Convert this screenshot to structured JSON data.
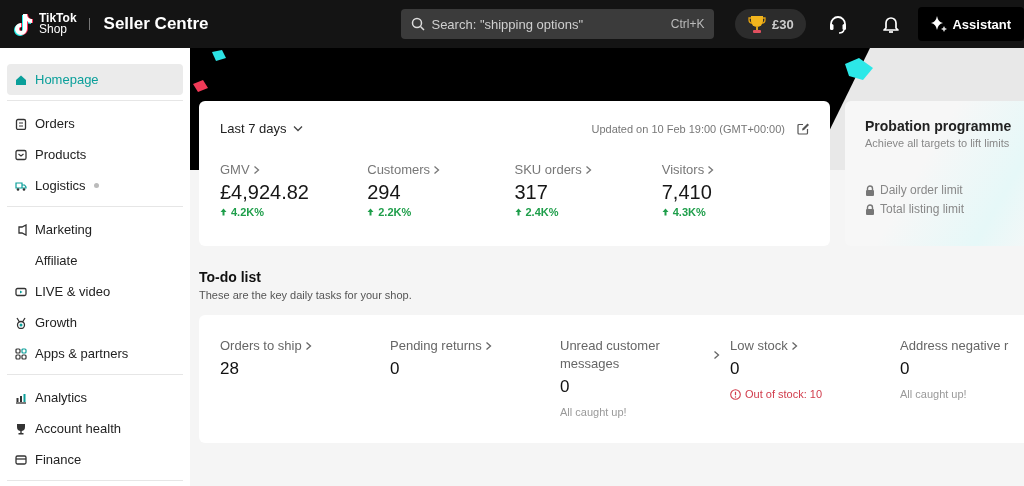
{
  "header": {
    "logo_top": "TikTok",
    "logo_bottom": "Shop",
    "title": "Seller Centre",
    "search": {
      "placeholder": "Search: \"shipping options\"",
      "shortcut": "Ctrl+K"
    },
    "reward": "£30",
    "assistant": "Assistant"
  },
  "sidebar": {
    "sections": [
      {
        "items": [
          {
            "label": "Homepage",
            "selected": true,
            "dot": false
          }
        ]
      },
      {
        "items": [
          {
            "label": "Orders",
            "selected": false,
            "dot": false
          },
          {
            "label": "Products",
            "selected": false,
            "dot": false
          },
          {
            "label": "Logistics",
            "selected": false,
            "dot": true
          }
        ]
      },
      {
        "items": [
          {
            "label": "Marketing",
            "selected": false,
            "dot": false
          },
          {
            "label": "Affiliate",
            "selected": false,
            "dot": false
          },
          {
            "label": "LIVE & video",
            "selected": false,
            "dot": false
          },
          {
            "label": "Growth",
            "selected": false,
            "dot": false
          },
          {
            "label": "Apps & partners",
            "selected": false,
            "dot": false
          }
        ]
      },
      {
        "items": [
          {
            "label": "Analytics",
            "selected": false,
            "dot": false
          },
          {
            "label": "Account health",
            "selected": false,
            "dot": false
          },
          {
            "label": "Finance",
            "selected": false,
            "dot": false
          }
        ]
      }
    ]
  },
  "stats": {
    "period": "Last 7 days",
    "updated": "Updated on 10 Feb 19:00 (GMT+00:00)",
    "metrics": [
      {
        "label": "GMV",
        "value": "£4,924.82",
        "change": "4.2K%",
        "rising": true
      },
      {
        "label": "Customers",
        "value": "294",
        "change": "2.2K%",
        "rising": true
      },
      {
        "label": "SKU orders",
        "value": "317",
        "change": "2.4K%",
        "rising": true
      },
      {
        "label": "Visitors",
        "value": "7,410",
        "change": "4.3K%",
        "rising": true
      }
    ]
  },
  "probation": {
    "title": "Probation programme",
    "subtitle": "Achieve all targets to lift limits",
    "limits": [
      {
        "label": "Daily order limit",
        "locked": true
      },
      {
        "label": "Total listing limit",
        "locked": true
      }
    ]
  },
  "todo": {
    "title": "To-do list",
    "subtitle": "These are the key daily tasks for your shop.",
    "tasks": [
      {
        "label": "Orders to ship",
        "value": "28",
        "link": true
      },
      {
        "label": "Pending returns",
        "value": "0",
        "link": true
      },
      {
        "label": "Unread customer messages",
        "value": "0",
        "link": true,
        "note": "All caught up!",
        "alert": false
      },
      {
        "label": "Low stock",
        "value": "0",
        "link": true,
        "note": "Out of stock: 10",
        "alert": true
      },
      {
        "label": "Address negative r",
        "value": "0",
        "link": false,
        "note": "All caught up!",
        "alert": false
      }
    ]
  }
}
